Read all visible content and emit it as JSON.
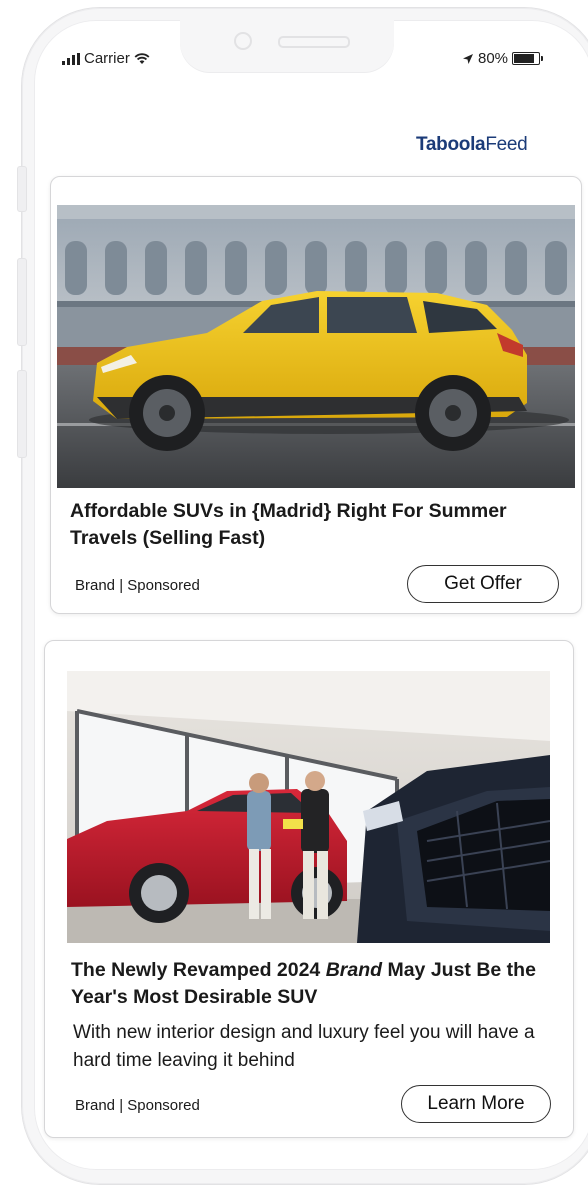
{
  "status_bar": {
    "carrier": "Carrier",
    "battery_percent": "80%",
    "icons": [
      "signal-bars-icon",
      "wifi-icon",
      "location-arrow-icon",
      "battery-icon"
    ]
  },
  "header": {
    "logo_brand": "Taboola",
    "logo_suffix": "Feed"
  },
  "cards": [
    {
      "image_alt": "Yellow SUV driving past a classical building",
      "title": "Affordable SUVs in {Madrid} Right For Summer Travels  (Selling Fast)",
      "brand_label": "Brand | Sponsored",
      "cta_label": "Get Offer"
    },
    {
      "image_alt": "Two men in a car showroom next to a red SUV",
      "title_part1": "The Newly Revamped 2024 ",
      "title_italic": "Brand",
      "title_part2": " May Just Be the Year's Most Desirable SUV",
      "description": "With new interior design and luxury feel you will have a hard time leaving it behind",
      "brand_label": "Brand | Sponsored",
      "cta_label": "Learn More"
    }
  ],
  "colors": {
    "logo": "#1b3b78",
    "suv_yellow": "#f2c417",
    "suv_red": "#c21e2b"
  }
}
